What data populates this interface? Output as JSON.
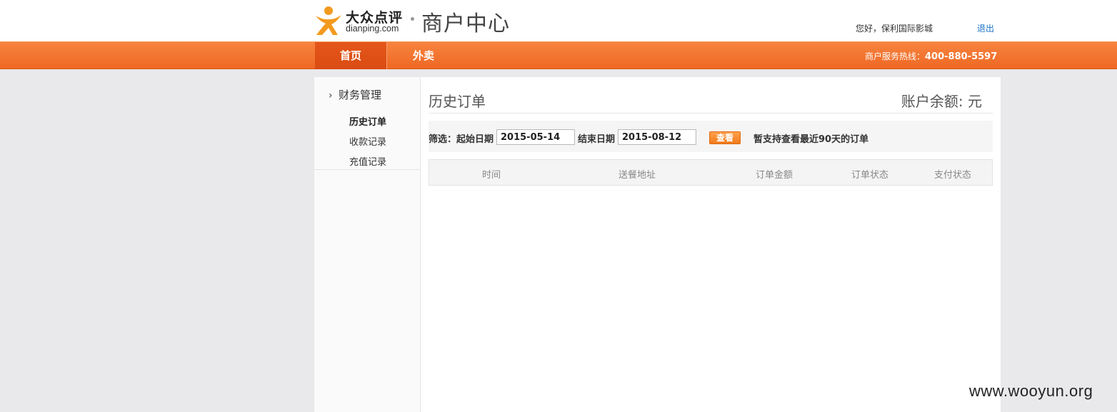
{
  "header": {
    "logo_cn": "大众点评",
    "logo_en": "dianping.com",
    "center_title": "商户中心",
    "greeting": "您好，保利国际影城",
    "logout_label": "退出",
    "colors": {
      "accent": "#ee6824",
      "logo_orange": "#f39a1e"
    }
  },
  "nav": {
    "tabs": [
      {
        "label": "首页",
        "active": true
      },
      {
        "label": "外卖",
        "active": false
      }
    ],
    "hotline_label": "商户服务热线：",
    "hotline_number": "400-880-5597"
  },
  "sidebar": {
    "section_label": "财务管理",
    "items": [
      {
        "label": "历史订单",
        "active": true
      },
      {
        "label": "收款记录",
        "active": false
      },
      {
        "label": "充值记录",
        "active": false
      }
    ]
  },
  "main": {
    "page_title": "历史订单",
    "balance_label": "账户余额: 元",
    "filter": {
      "prefix_label": "筛选：起始日期",
      "start_date": "2015-05-14",
      "end_label": "结束日期",
      "end_date": "2015-08-12",
      "query_button": "查看",
      "note": "暂支持查看最近90天的订单"
    },
    "table": {
      "columns": [
        "时间",
        "送餐地址",
        "订单金额",
        "订单状态",
        "支付状态"
      ],
      "rows": []
    }
  },
  "watermark": "www.wooyun.org"
}
